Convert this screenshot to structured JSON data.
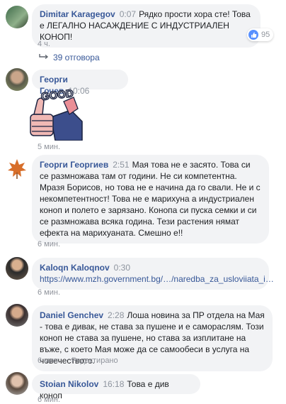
{
  "comments": [
    {
      "author": "Dimitar Karagegov",
      "time": "0:07",
      "text": "Рядко прости хора сте! Това е ЛЕГАЛНО НАСАЖДЕНИЕ С ИНДУСТРИАЛЕН КОНОП!",
      "age": "4 ч.",
      "reactions": "95",
      "replies": "39 отговора"
    },
    {
      "author": "Георги Гочев",
      "time": "10:06",
      "sticker_text": "GOOD",
      "age": "5 мин."
    },
    {
      "author": "Георги Георгиев",
      "time": "2:51",
      "text": "Мая това не е засято. Това си се размножава там от години. Не си компетентна. Мразя Борисов, но това не е начина да го свали. Не и с некомпетентност! Това не е марихуна а индустриален коноп и полето е зарязано. Конопа си пуска семки и си се размножава всяка година. Тези растения нямат ефекта на марихуаната. Смешно е!!",
      "age": "6 мин."
    },
    {
      "author": "Kaloqn Kaloqnov",
      "time": "0:30",
      "link": "https://www.mzh.government.bg/…/naredba_za_usloviiata_i…",
      "age": "6 мин."
    },
    {
      "author": "Daniel Genchev",
      "time": "2:28",
      "text": "Лоша новина за ПР отдела на Мая - това е дивак, не става за пушене и е самораслям. Този коноп не става за пушене, но става за изплитане на въже, с което Мая може да се самообеси в услуга на човечеството.",
      "age": "6 мин.",
      "edited": "Редактирано"
    },
    {
      "author": "Stoian Nikolov",
      "time": "16:18",
      "text": "Това е див коноп",
      "age": "6 мин."
    }
  ]
}
